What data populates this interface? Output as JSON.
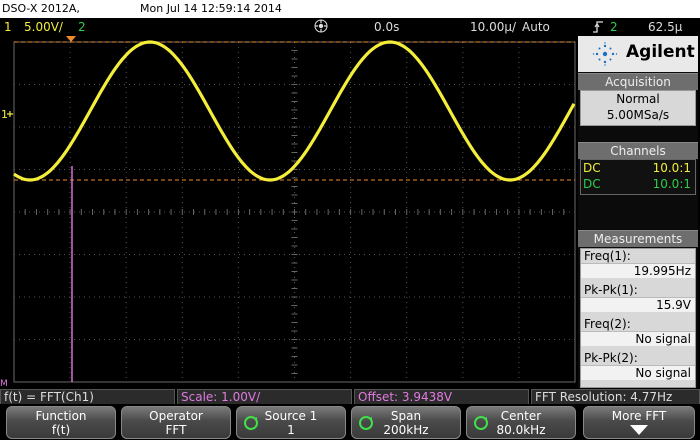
{
  "header": {
    "model": "DSO-X 2012A,",
    "datetime": "Mon Jul 14 12:59:14 2014"
  },
  "topbar": {
    "ch1_num": "1",
    "ch1_scale": "5.00V/",
    "ch2_num": "2",
    "time_offset": "0.0s",
    "timebase": "10.00µ/",
    "trigger_mode": "Auto",
    "trigger_channel": "2",
    "trigger_level": "62.5µ"
  },
  "brand": {
    "name": "Agilent"
  },
  "acquisition": {
    "title": "Acquisition",
    "mode": "Normal",
    "rate": "5.00MSa/s"
  },
  "channels": {
    "title": "Channels",
    "rows": [
      {
        "coupling": "DC",
        "probe": "10.0:1",
        "color": "#f4ee3a"
      },
      {
        "coupling": "DC",
        "probe": "10.0:1",
        "color": "#2fcc4a"
      }
    ]
  },
  "measurements": {
    "title": "Measurements",
    "items": [
      {
        "label": "Freq(1):",
        "value": "19.995Hz"
      },
      {
        "label": "Pk-Pk(1):",
        "value": "15.9V"
      },
      {
        "label": "Freq(2):",
        "value": "No signal"
      },
      {
        "label": "Pk-Pk(2):",
        "value": "No signal"
      }
    ]
  },
  "screen_markers": {
    "ch1": "1",
    "math": "M"
  },
  "status": {
    "math_def": "f(t) = FFT(Ch1)",
    "scale": "Scale: 1.00V/",
    "offset": "Offset: 3.9438V",
    "fft_res": "FFT Resolution: 4.77Hz"
  },
  "softkeys": [
    {
      "label": "Function",
      "value": "f(t)"
    },
    {
      "label": "Operator",
      "value": "FFT"
    },
    {
      "label": "Source 1",
      "value": "1"
    },
    {
      "label": "Span",
      "value": "200kHz"
    },
    {
      "label": "Center",
      "value": "80.0kHz"
    },
    {
      "label": "More FFT",
      "value": ""
    }
  ],
  "colors": {
    "ch1": "#f4ee3a",
    "ch2": "#2fcc4a",
    "math": "#e07be0",
    "trigger": "#f08a2a",
    "grid": "#555555"
  }
}
